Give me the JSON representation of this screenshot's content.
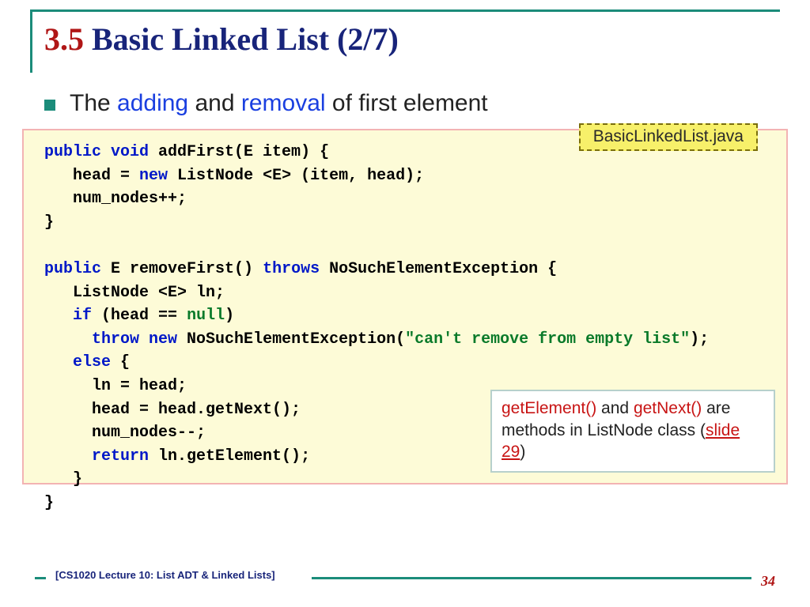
{
  "title": {
    "num": "3.5",
    "rest": " Basic Linked List (2/7)"
  },
  "bullet": {
    "pre": "The ",
    "hl1": "adding",
    "mid": " and ",
    "hl2": "removal",
    "post": " of first element"
  },
  "file_label": "BasicLinkedList.java",
  "code": {
    "l1_kw": "public void",
    "l1_rest": " addFirst(E item) {",
    "l2": "   head = ",
    "l2_kw": "new",
    "l2_rest": " ListNode <E> (item, head);",
    "l3": "   num_nodes++;",
    "l4": "}",
    "blank": "",
    "l6_kw": "public",
    "l6_mid": " E removeFirst() ",
    "l6_kw2": "throws",
    "l6_rest": " NoSuchElementException {",
    "l7": "   ListNode <E> ln;",
    "l8a": "   ",
    "l8_kw": "if",
    "l8b": " (head == ",
    "l8_lit": "null",
    "l8c": ")",
    "l9a": "     ",
    "l9_kw": "throw new",
    "l9b": " NoSuchElementException(",
    "l9_str": "\"can't remove from empty list\"",
    "l9c": ");",
    "l10a": "   ",
    "l10_kw": "else",
    "l10b": " {",
    "l11": "     ln = head;",
    "l12": "     head = head.getNext();",
    "l13": "     num_nodes--;",
    "l14a": "     ",
    "l14_kw": "return",
    "l14b": " ln.getElement();",
    "l15": "   }",
    "l16": "}"
  },
  "note": {
    "m1": "getElement()",
    "t1": " and ",
    "m2": "getNext()",
    "t2": " are methods in ListNode class (",
    "link": "slide 29",
    "t3": ")"
  },
  "footer": "[CS1020 Lecture 10: List ADT & Linked Lists]",
  "page": "34"
}
